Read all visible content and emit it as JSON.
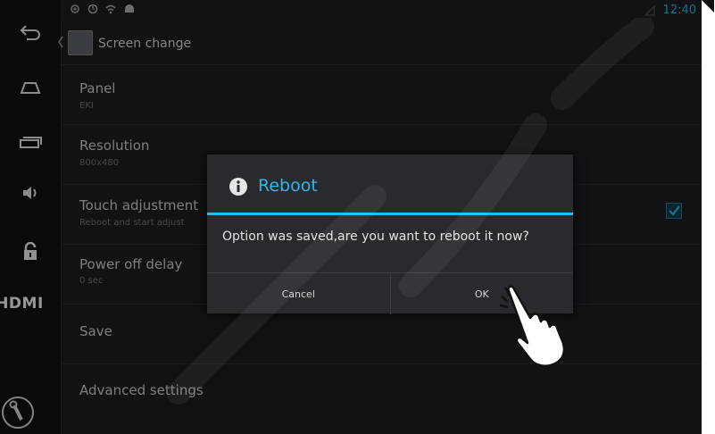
{
  "statusbar": {
    "clock": "12:40",
    "icons": [
      "gps-icon",
      "sync-icon",
      "wifi-icon",
      "android-icon",
      "signal-icon"
    ]
  },
  "sidebar": {
    "items": [
      {
        "name": "back-icon"
      },
      {
        "name": "home-icon"
      },
      {
        "name": "recent-apps-icon"
      },
      {
        "name": "volume-icon"
      },
      {
        "name": "lock-icon"
      },
      {
        "name": "hdmi-button",
        "label": "HDMI"
      },
      {
        "name": "settings-wrench-icon"
      }
    ]
  },
  "actionbar": {
    "title": "Screen change"
  },
  "preferences": [
    {
      "title": "Panel",
      "summary": "EKI"
    },
    {
      "title": "Resolution",
      "summary": "800x480"
    },
    {
      "title": "Touch adjustment",
      "summary": "Reboot and start adjust"
    },
    {
      "title": "Power off delay",
      "summary": "0 sec"
    },
    {
      "title": "Save",
      "summary": ""
    },
    {
      "title": "Advanced settings",
      "summary": ""
    }
  ],
  "touch_checkbox": {
    "checked": true
  },
  "dialog": {
    "title": "Reboot",
    "message": "Option was saved,are you want to reboot it now?",
    "cancel_label": "Cancel",
    "ok_label": "OK"
  },
  "colors": {
    "accent": "#33b5e5",
    "background": "#1b1c1e",
    "sidebar": "#0f1011",
    "dialog": "#282a2d"
  }
}
